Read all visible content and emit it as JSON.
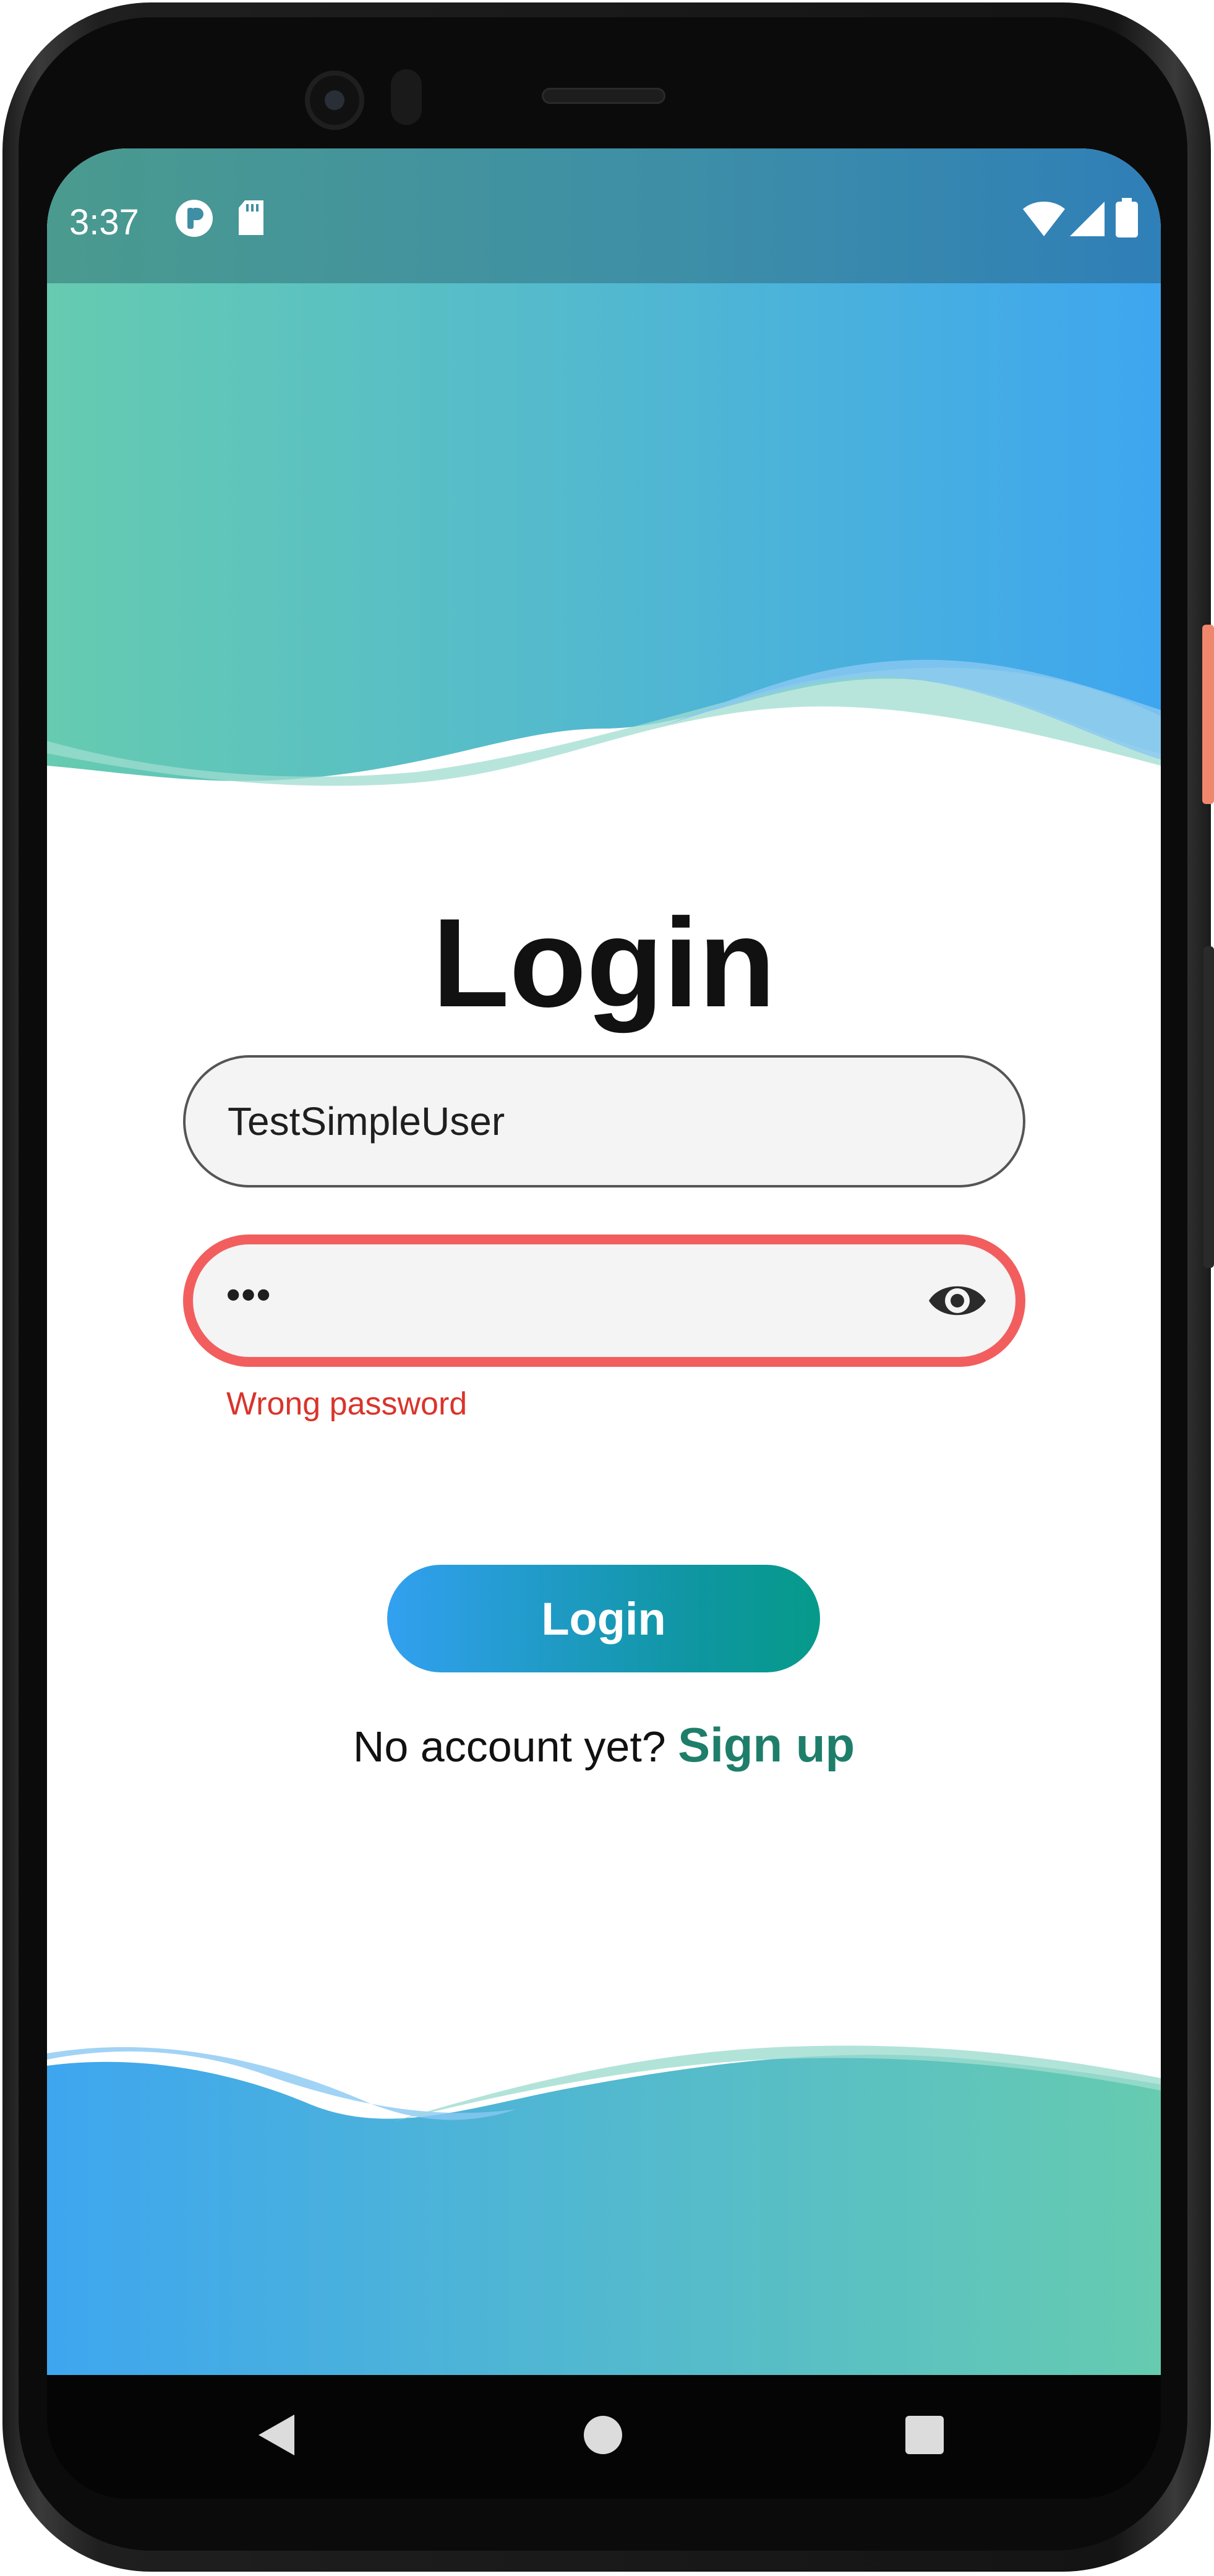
{
  "status_bar": {
    "time": "3:37",
    "icons_left": [
      "app-notification-icon",
      "sd-card-icon"
    ],
    "icons_right": [
      "wifi-icon",
      "signal-icon",
      "battery-icon"
    ]
  },
  "page": {
    "title": "Login"
  },
  "username": {
    "value": "TestSimpleUser"
  },
  "password": {
    "value": "•••",
    "error": "Wrong password",
    "toggle_icon": "eye-icon"
  },
  "login_button": {
    "label": "Login"
  },
  "signup": {
    "prompt": "No account yet?",
    "link": "Sign up"
  },
  "colors": {
    "error": "#f25e5e",
    "error_text": "#d9342b",
    "gradient_start": "#32a0f0",
    "gradient_end": "#069a8a",
    "link": "#1e7e6a",
    "wave_green": "#66cbb0",
    "wave_blue": "#3ea6ef"
  },
  "nav_bar": {
    "buttons": [
      "back-icon",
      "home-icon",
      "recents-icon"
    ]
  }
}
